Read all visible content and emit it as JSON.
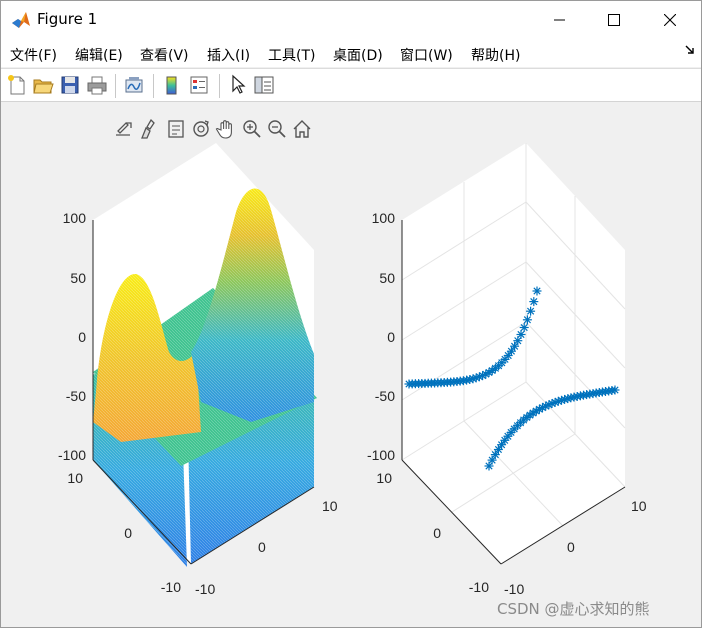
{
  "window": {
    "title": "Figure 1",
    "icons": {
      "app": "matlab-icon",
      "minimize": "minimize-icon",
      "maximize": "maximize-icon",
      "close": "close-icon"
    }
  },
  "menu": [
    "文件(F)",
    "编辑(E)",
    "查看(V)",
    "插入(I)",
    "工具(T)",
    "桌面(D)",
    "窗口(W)",
    "帮助(H)"
  ],
  "toolbar": {
    "buttons": [
      "new-figure-icon",
      "open-file-icon",
      "save-icon",
      "print-icon",
      "link-plot-icon",
      "insert-colorbar-icon",
      "insert-legend-icon",
      "edit-plot-icon",
      "property-inspector-icon"
    ]
  },
  "axes_toolbar": {
    "buttons": [
      "export-icon",
      "brush-icon",
      "data-tips-icon",
      "rotate-3d-icon",
      "pan-icon",
      "zoom-in-icon",
      "zoom-out-icon",
      "restore-view-icon"
    ]
  },
  "chart_data": [
    {
      "type": "surface",
      "description_source": "surf plot",
      "zticks": [
        "100",
        "50",
        "0",
        "-50",
        "-100"
      ],
      "xticks": [
        "10",
        "0",
        "-10"
      ],
      "yticks": [
        "-10",
        "0",
        "10"
      ],
      "zlim": [
        -100,
        100
      ],
      "xlim": [
        -10,
        10
      ],
      "ylim": [
        -10,
        10
      ],
      "colormap": "parula",
      "colors": {
        "low": "#3ea9e6",
        "mid": "#3cbf9a",
        "high": "#f6e819",
        "peak": "#f9a82e"
      }
    },
    {
      "type": "scatter3",
      "marker": "*",
      "marker_color": "#0072bd",
      "zticks": [
        "100",
        "50",
        "0",
        "-50",
        "-100"
      ],
      "xticks": [
        "10",
        "0",
        "-10"
      ],
      "yticks": [
        "-10",
        "0",
        "10"
      ],
      "zlim": [
        -100,
        100
      ],
      "xlim": [
        -10,
        10
      ],
      "ylim": [
        -10,
        10
      ],
      "grid": true
    }
  ],
  "watermark": "CSDN @虚心求知的熊"
}
